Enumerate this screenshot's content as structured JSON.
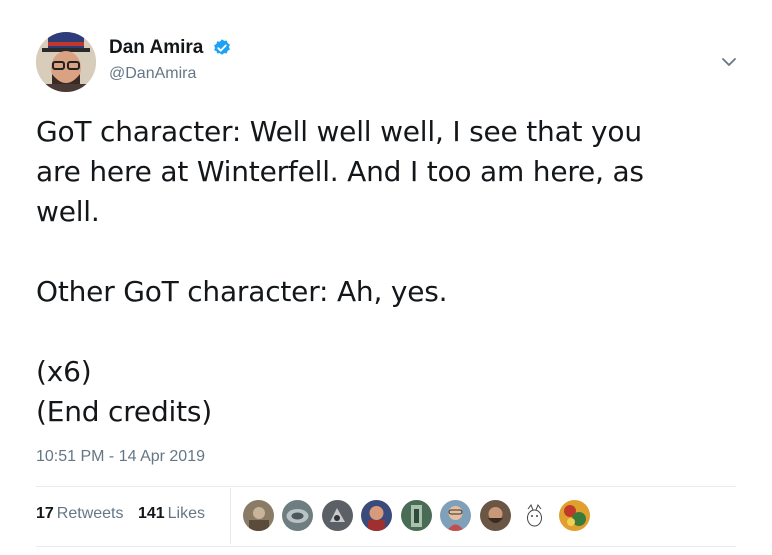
{
  "author": {
    "display_name": "Dan Amira",
    "handle": "@DanAmira",
    "verified": true,
    "avatar_icon": "user-avatar-photo"
  },
  "tweet": {
    "paragraphs": [
      [
        "GoT character: Well well well, I see that you",
        "are here at Winterfell. And I too am here, as",
        "well."
      ],
      [
        "Other GoT character: Ah, yes."
      ],
      [
        "(x6)",
        "(End credits)"
      ]
    ],
    "timestamp": "10:51 PM - 14 Apr 2019"
  },
  "stats": {
    "retweets_count": "17",
    "retweets_label": "Retweets",
    "likes_count": "141",
    "likes_label": "Likes"
  },
  "likers": [
    {
      "icon": "liker-avatar-1",
      "color": "#8a7b66"
    },
    {
      "icon": "liker-avatar-2",
      "color": "#6d7d80"
    },
    {
      "icon": "liker-avatar-3",
      "color": "#5b5f66"
    },
    {
      "icon": "liker-avatar-4",
      "color": "#3a4a7a"
    },
    {
      "icon": "liker-avatar-5",
      "color": "#4a6b55"
    },
    {
      "icon": "liker-avatar-6",
      "color": "#7fa0b8"
    },
    {
      "icon": "liker-avatar-7",
      "color": "#6b5545"
    },
    {
      "icon": "liker-avatar-8",
      "color": "#f2f2f2"
    },
    {
      "icon": "liker-avatar-9",
      "color": "#e0a030"
    }
  ],
  "colors": {
    "verified_blue": "#1da1f2",
    "secondary_text": "#657786",
    "primary_text": "#14171a",
    "divider": "#e6ecf0"
  }
}
